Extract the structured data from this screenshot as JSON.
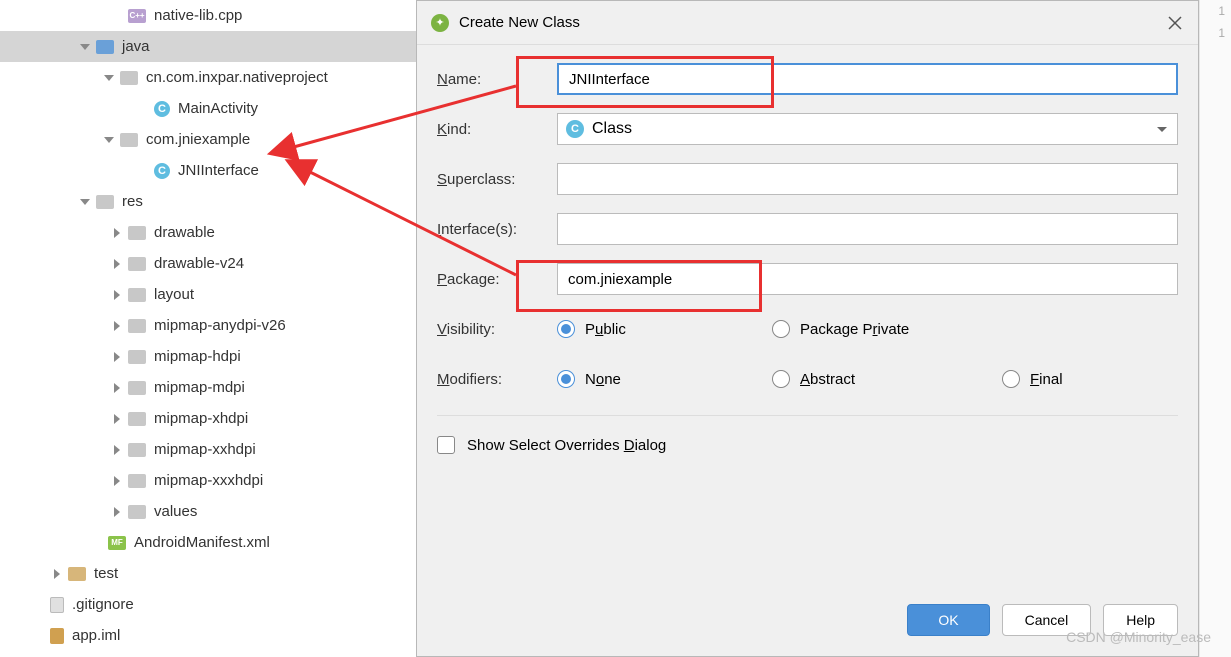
{
  "tree": {
    "items": [
      {
        "indent": 110,
        "arrow": "",
        "icon": "cpp",
        "iconText": "C++",
        "label": "native-lib.cpp"
      },
      {
        "indent": 78,
        "arrow": "down",
        "icon": "folder-blue",
        "iconText": "",
        "label": "java",
        "selected": true
      },
      {
        "indent": 102,
        "arrow": "down",
        "icon": "pkg",
        "iconText": "",
        "label": "cn.com.inxpar.nativeproject"
      },
      {
        "indent": 136,
        "arrow": "",
        "icon": "c",
        "iconText": "C",
        "label": "MainActivity"
      },
      {
        "indent": 102,
        "arrow": "down",
        "icon": "pkg",
        "iconText": "",
        "label": "com.jniexample"
      },
      {
        "indent": 136,
        "arrow": "",
        "icon": "c",
        "iconText": "C",
        "label": "JNIInterface"
      },
      {
        "indent": 78,
        "arrow": "down",
        "icon": "pkg-res",
        "iconText": "",
        "label": "res"
      },
      {
        "indent": 110,
        "arrow": "right",
        "icon": "pkg",
        "iconText": "",
        "label": "drawable"
      },
      {
        "indent": 110,
        "arrow": "right",
        "icon": "pkg",
        "iconText": "",
        "label": "drawable-v24"
      },
      {
        "indent": 110,
        "arrow": "right",
        "icon": "pkg",
        "iconText": "",
        "label": "layout"
      },
      {
        "indent": 110,
        "arrow": "right",
        "icon": "pkg",
        "iconText": "",
        "label": "mipmap-anydpi-v26"
      },
      {
        "indent": 110,
        "arrow": "right",
        "icon": "pkg",
        "iconText": "",
        "label": "mipmap-hdpi"
      },
      {
        "indent": 110,
        "arrow": "right",
        "icon": "pkg",
        "iconText": "",
        "label": "mipmap-mdpi"
      },
      {
        "indent": 110,
        "arrow": "right",
        "icon": "pkg",
        "iconText": "",
        "label": "mipmap-xhdpi"
      },
      {
        "indent": 110,
        "arrow": "right",
        "icon": "pkg",
        "iconText": "",
        "label": "mipmap-xxhdpi"
      },
      {
        "indent": 110,
        "arrow": "right",
        "icon": "pkg",
        "iconText": "",
        "label": "mipmap-xxxhdpi"
      },
      {
        "indent": 110,
        "arrow": "right",
        "icon": "pkg",
        "iconText": "",
        "label": "values"
      },
      {
        "indent": 90,
        "arrow": "",
        "icon": "mf",
        "iconText": "MF",
        "label": "AndroidManifest.xml"
      },
      {
        "indent": 50,
        "arrow": "right",
        "icon": "folder",
        "iconText": "",
        "label": "test"
      },
      {
        "indent": 32,
        "arrow": "",
        "icon": "file",
        "iconText": "",
        "label": ".gitignore"
      },
      {
        "indent": 32,
        "arrow": "",
        "icon": "iml",
        "iconText": "",
        "label": "app.iml"
      }
    ]
  },
  "dialog": {
    "title": "Create New Class",
    "labels": {
      "name": "Name:",
      "kind": "Kind:",
      "superclass": "Superclass:",
      "interfaces": "Interface(s):",
      "package": "Package:",
      "visibility": "Visibility:",
      "modifiers": "Modifiers:"
    },
    "values": {
      "name": "JNIInterface",
      "kind": "Class",
      "superclass": "",
      "interfaces": "",
      "package": "com.jniexample"
    },
    "visibility": {
      "public": "Public",
      "package_private": "Package Private"
    },
    "modifiers": {
      "none": "None",
      "abstract": "Abstract",
      "final": "Final"
    },
    "show_overrides": "Show Select Overrides Dialog",
    "buttons": {
      "ok": "OK",
      "cancel": "Cancel",
      "help": "Help"
    }
  },
  "watermark": "CSDN @Minority_ease",
  "line_numbers": [
    "1",
    "1"
  ]
}
